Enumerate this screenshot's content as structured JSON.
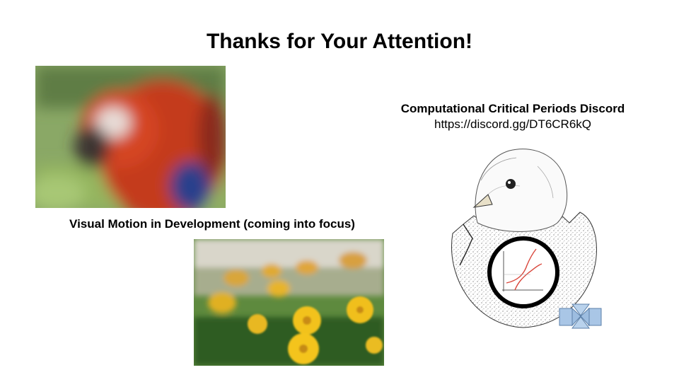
{
  "slide": {
    "title": "Thanks for Your Attention!",
    "caption": "Visual Motion in Development (coming into focus)",
    "discord_title": "Computational Critical Periods Discord",
    "discord_link": "https://discord.gg/DT6CR6kQ"
  },
  "colors": {
    "curve": "#d9463b",
    "icon_fill": "#a9c6e6",
    "icon_stroke": "#5b7fa8",
    "ring": "#000000"
  }
}
